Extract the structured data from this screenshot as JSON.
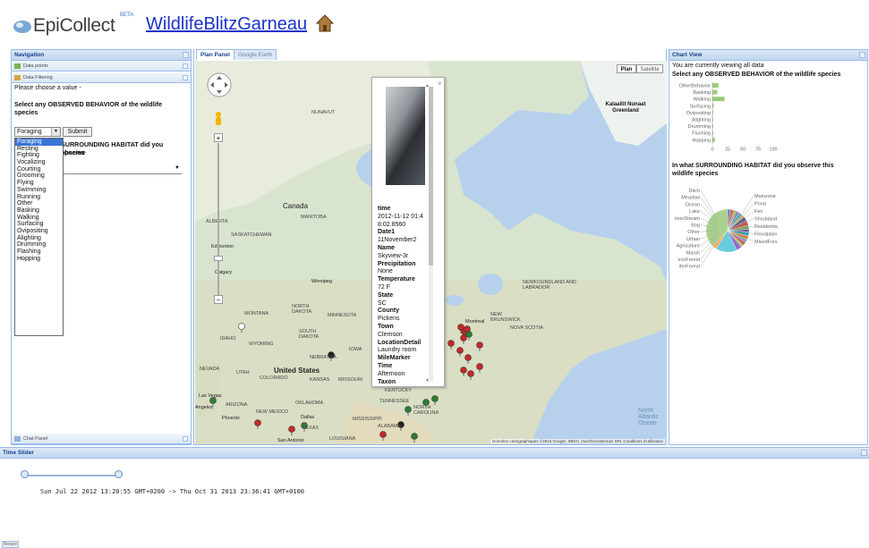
{
  "header": {
    "app_name": "EpiCollect",
    "beta": "BETA",
    "project": "WildlifeBlitzGarneau"
  },
  "navigation": {
    "title": "Navigation",
    "data_points": "Data points",
    "data_filtering": "Data Filtering",
    "choose_value": "Please choose a value -",
    "question_behavior": "Select any OBSERVED BEHAVIOR of the wildlife species",
    "selected_behavior": "Foraging",
    "submit_label": "Submit",
    "question_habitat_a": "SURROUNDING HABITAT did you observe",
    "question_habitat_b": "species",
    "behavior_options": [
      "Foraging",
      "Resting",
      "Fighting",
      "Vocalizing",
      "Courting",
      "Grooming",
      "Flying",
      "Swimming",
      "Running",
      "Other",
      "Basking",
      "Walking",
      "Surfacing",
      "Ovipositing",
      "Alighting",
      "Drumming",
      "Flashing",
      "Hopping"
    ],
    "chat_panel": "Chat Panel"
  },
  "map_panel": {
    "tab_plan": "Plan Panel",
    "tab_earth": "Google Earth",
    "plan_button": "Plan",
    "satellite_button": "Satellite",
    "copyright": "Données cartographiques ©2015 Google, INEGI, Inav/Geosistemas SRL   Conditions d'utilisation",
    "labels": {
      "canada": "Canada",
      "united_states": "United States",
      "greenland": "Kalaallit Nunaat Greenland",
      "nunavut": "NUNAVUT",
      "alberta": "ALBERTA",
      "manitoba": "MANITOBA",
      "saskatchewan": "SASKATCHEWAN",
      "edmonton": "Edmonton",
      "calgary": "Calgary",
      "winnipeg": "Winnipeg",
      "montana": "MONTANA",
      "north_dakota": "NORTH DAKOTA",
      "south_dakota": "SOUTH DAKOTA",
      "minnesota": "MINNESOTA",
      "wyoming": "WYOMING",
      "idaho": "IDAHO",
      "nebraska": "NEBRASKA",
      "iowa": "IOWA",
      "nevada": "NEVADA",
      "utah": "UTAH",
      "colorado": "COLORADO",
      "kansas": "KANSAS",
      "missouri": "MISSOURI",
      "kentucky": "KENTUCKY",
      "tennessee": "TENNESSEE",
      "oklahoma": "OKLAHOMA",
      "arizona": "ARIZONA",
      "new_mexico": "NEW MEXICO",
      "texas": "TEXAS",
      "mississippi": "MISSISSIPPI",
      "alabama": "ALABAMA",
      "louisiana": "LOUISIANA",
      "las_vegas": "Las Vegas",
      "angeles": "Angeles",
      "phoenix": "Phoenix",
      "dallas": "Dallas",
      "san_antonio": "San Antonio",
      "north_carolina": "NORTH CAROLINA",
      "montreal": "Montreal",
      "new_brunswick": "NEW BRUNSWICK",
      "nova_scotia": "NOVA SCOTIA",
      "newfoundland": "NEWFOUNDLAND AND LABRADOR",
      "north_atlantic": "North Atlantic Ocean"
    }
  },
  "popup": {
    "close": "×",
    "fields": [
      {
        "key": "time",
        "value": "2012-11-12 01:48:02.8560"
      },
      {
        "key": "Date1",
        "value": "11November2"
      },
      {
        "key": "Name",
        "value": "Skyview-3r"
      },
      {
        "key": "Precipitation",
        "value": "None"
      },
      {
        "key": "Temperature",
        "value": "72 F"
      },
      {
        "key": "State",
        "value": "SC"
      },
      {
        "key": "County",
        "value": "Pickens"
      },
      {
        "key": "Town",
        "value": "Clemson"
      },
      {
        "key": "LocationDetail",
        "value": "Laundry room"
      },
      {
        "key": "MileMarker",
        "value": ""
      },
      {
        "key": "Time",
        "value": "Afternoon"
      },
      {
        "key": "Taxon",
        "value": ""
      }
    ]
  },
  "chart_view": {
    "title": "Chart View",
    "note": "You are currently viewing all data",
    "behavior_title": "Select any OBSERVED BEHAVIOR of the wildlife species",
    "habitat_title": "In what SURROUNDING HABITAT did you observe this wildlife species"
  },
  "chart_data": [
    {
      "type": "bar",
      "orientation": "horizontal",
      "title": "Select any OBSERVED BEHAVIOR of the wildlife species",
      "categories": [
        "OtherBehavior",
        "Basking",
        "Walking",
        "Surfacing",
        "Ovipositing",
        "Alighting",
        "Drumming",
        "Flushing",
        "Hopping"
      ],
      "values": [
        10,
        8,
        20,
        2,
        1,
        1,
        1,
        1,
        4
      ],
      "xticks": [
        "0",
        "25",
        "50",
        "75",
        "100"
      ],
      "xlim": [
        0,
        100
      ],
      "color": "#9ccc7a"
    },
    {
      "type": "pie",
      "title": "In what SURROUNDING HABITAT did you observe this wildlife species",
      "labels": [
        "Ditch",
        "Meadow",
        "Ocean",
        "Lake",
        "riverStream",
        "Bog",
        "Other",
        "Urban",
        "Agriculture",
        "Marsh",
        "ecoForest",
        "iferForest",
        "Mainzone",
        "Pond",
        "Fen",
        "Shrubland",
        "Residentia",
        "Floodplain",
        "MixedFors"
      ],
      "values": [
        2,
        3,
        2,
        2,
        3,
        2,
        3,
        4,
        3,
        2,
        3,
        3,
        2,
        3,
        2,
        4,
        16,
        3,
        38
      ],
      "colors": [
        "#4e7fbf",
        "#e06666",
        "#8fbf5a",
        "#9b6fc4",
        "#4bb0c6",
        "#f2a04a",
        "#3a5a8f",
        "#c94f4f",
        "#6aa84f",
        "#7453a8",
        "#2e9ab0",
        "#d9822b",
        "#6699cc",
        "#cc6666",
        "#99cc66",
        "#9966cc",
        "#66ccdd",
        "#ffaa55",
        "#a9d18e"
      ]
    }
  ],
  "time_slider": {
    "title": "Time Slider",
    "range_text": "Sun Jul 22 2012 13:20:55 GMT+0200 -> Thu Oct 31 2013 23:36:41 GMT+0100",
    "resize_label": "Resize"
  }
}
